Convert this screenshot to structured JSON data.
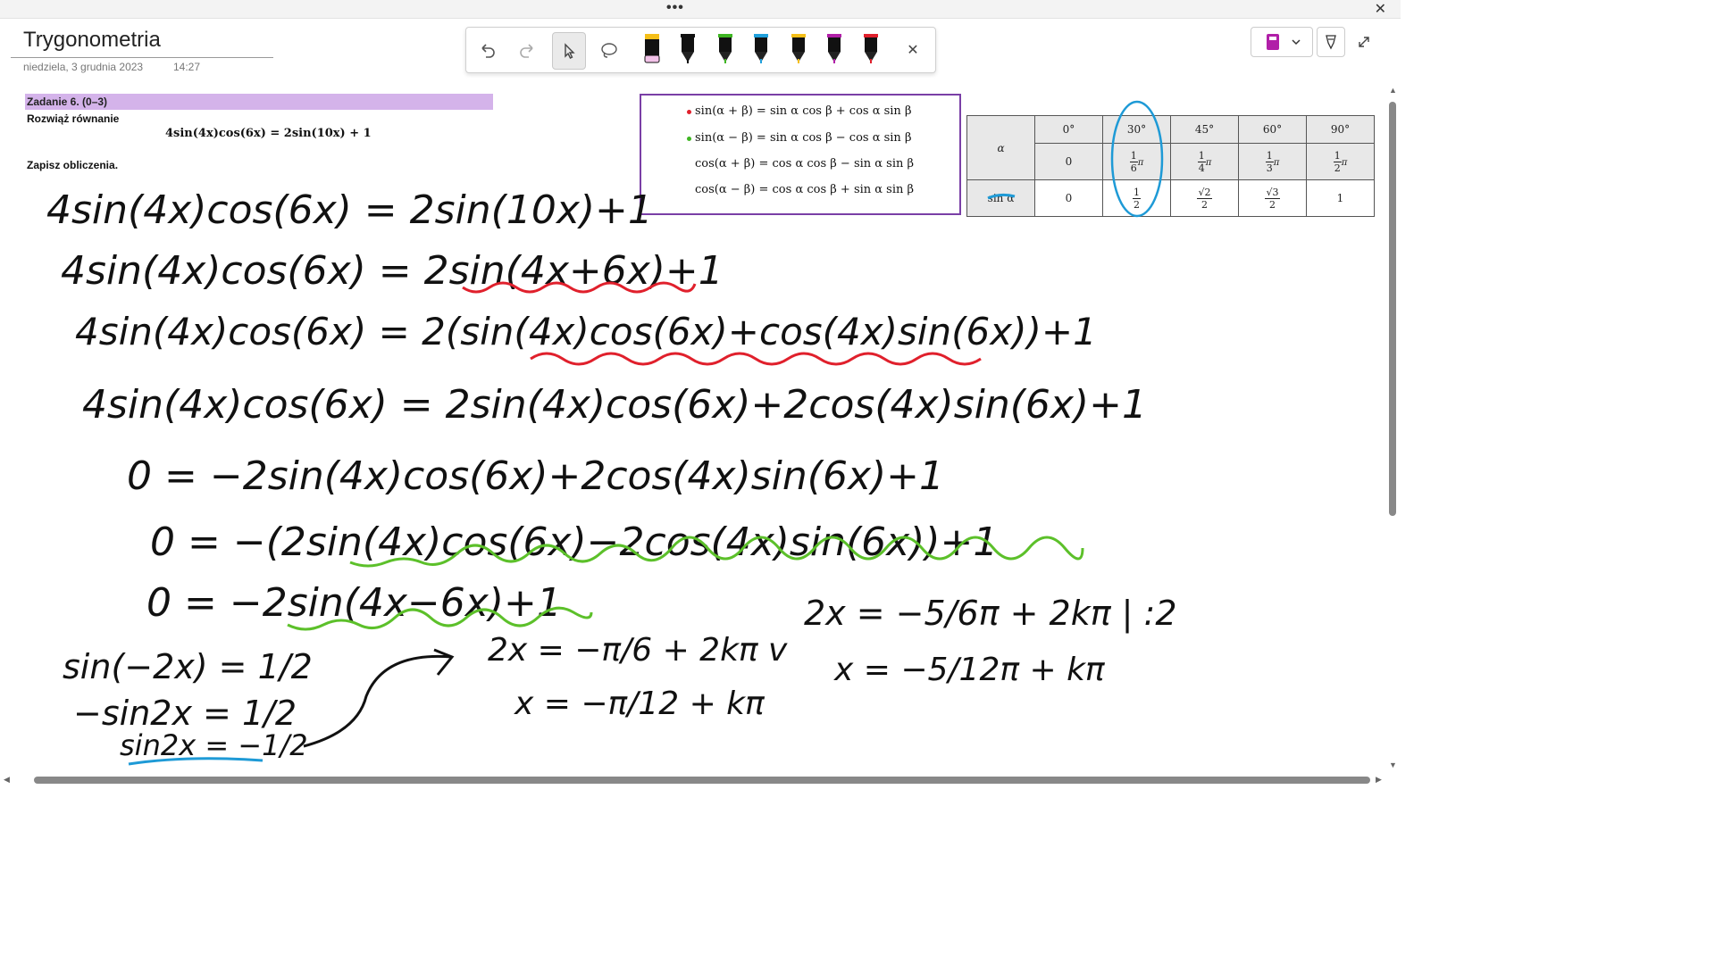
{
  "window": {
    "menu_dots": "•••",
    "close_glyph": "✕"
  },
  "page": {
    "title": "Trygonometria",
    "date": "niedziela, 3 grudnia 2023",
    "time": "14:27"
  },
  "toolbar": {
    "tools": [
      "undo-icon",
      "redo-icon",
      "select-pointer-icon",
      "lasso-icon"
    ],
    "pens": [
      {
        "name": "highlighter",
        "color": "#f2c2e8"
      },
      {
        "name": "black",
        "color": "#111111"
      },
      {
        "name": "green",
        "color": "#3fb623"
      },
      {
        "name": "blue",
        "color": "#20a0dc"
      },
      {
        "name": "yellow",
        "color": "#f5bf18"
      },
      {
        "name": "purple",
        "color": "#b11fa8"
      },
      {
        "name": "red",
        "color": "#e0202c"
      }
    ],
    "close_glyph": "✕"
  },
  "task": {
    "header": "Zadanie 6. (0–3)",
    "instruction": "Rozwiąż równanie",
    "equation": "4sin(4x)cos(6x) = 2sin(10x) + 1",
    "footer": "Zapisz obliczenia."
  },
  "formulas": [
    {
      "text": "sin(α + β) = sin α cos β + cos α sin β",
      "dot_color": "#e0202c"
    },
    {
      "text": "sin(α − β) = sin α cos β − cos α sin β",
      "dot_color": "#3fb623"
    },
    {
      "text": "cos(α + β) = cos α cos β − sin α sin β",
      "dot_color": ""
    },
    {
      "text": "cos(α − β) = cos α cos β + sin α sin β",
      "dot_color": ""
    }
  ],
  "trig_table": {
    "degrees": [
      "0°",
      "30°",
      "45°",
      "60°",
      "90°"
    ],
    "alpha_label": "α",
    "radians": [
      {
        "whole": "0"
      },
      {
        "num": "1",
        "den": "6",
        "suffix": "π"
      },
      {
        "num": "1",
        "den": "4",
        "suffix": "π"
      },
      {
        "num": "1",
        "den": "3",
        "suffix": "π"
      },
      {
        "num": "1",
        "den": "2",
        "suffix": "π"
      }
    ],
    "sin_label": "sin α",
    "sin_values": [
      {
        "whole": "0"
      },
      {
        "num": "1",
        "den": "2"
      },
      {
        "num": "√2",
        "den": "2"
      },
      {
        "num": "√3",
        "den": "2"
      },
      {
        "whole": "1"
      }
    ]
  },
  "handwriting": {
    "lines": [
      "4sin(4x)cos(6x) = 2sin(10x)+1",
      "4sin(4x)cos(6x) = 2sin(4x+6x)+1",
      "4sin(4x)cos(6x) = 2(sin(4x)cos(6x)+cos(4x)sin(6x))+1",
      "4sin(4x)cos(6x) = 2sin(4x)cos(6x)+2cos(4x)sin(6x)+1",
      "0 = −2sin(4x)cos(6x)+2cos(4x)sin(6x)+1",
      "0 = −(2sin(4x)cos(6x)−2cos(4x)sin(6x))+1",
      "0 = −2sin(4x−6x)+1",
      "sin(−2x) = 1/2",
      "−sin2x = 1/2",
      "sin2x = −1/2",
      "2x = −π/6 + 2kπ  v",
      "x = −π/12 + kπ",
      "2x = −5/6π + 2kπ | :2",
      "x = −5/12π + kπ"
    ],
    "ink_colors": {
      "black": "#111111",
      "red": "#e0202c",
      "green": "#5cc02a",
      "blue": "#1e9ad6"
    }
  },
  "scroll": {
    "up": "▲",
    "down": "▼",
    "left": "◀",
    "right": "▶"
  }
}
